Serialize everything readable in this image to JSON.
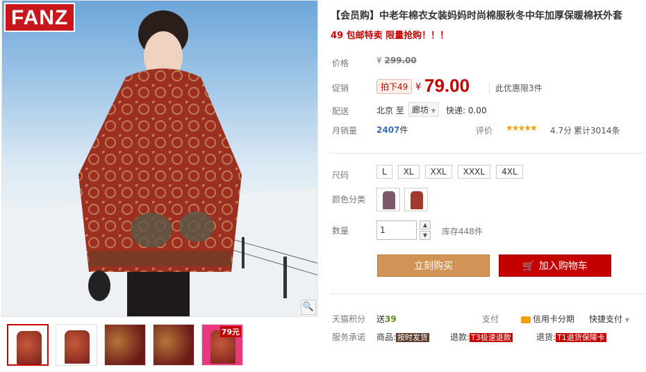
{
  "brand": "FANZ",
  "product": {
    "title": "【会员购】中老年棉衣女装妈妈时尚棉服秋冬中年加厚保暖棉袄外套",
    "subtitle": "49 包邮特卖 限量抢购！！！"
  },
  "price": {
    "label": "价格",
    "currency": "¥",
    "original": "299.00"
  },
  "promo": {
    "label": "促销",
    "tag": "拍下49",
    "currency": "¥",
    "price": "79.00",
    "limit": "此优惠限3件"
  },
  "shipping": {
    "label": "配送",
    "from": "北京 至",
    "destination": "廊坊",
    "fee": "快递: 0.00"
  },
  "sales": {
    "label": "月销量",
    "count": "2407",
    "unit": "件"
  },
  "rating": {
    "label": "评价",
    "stars": 4.7,
    "score": "4.7分",
    "count": "累计3014条"
  },
  "size": {
    "label": "尺码",
    "options": [
      "L",
      "XL",
      "XXL",
      "XXXL",
      "4XL"
    ]
  },
  "color": {
    "label": "颜色分类",
    "swatches": [
      "#7a5a6a",
      "#a03a2c"
    ]
  },
  "quantity": {
    "label": "数量",
    "value": "1",
    "stock": "库存448件"
  },
  "actions": {
    "buy": "立刻购买",
    "cart": "加入购物车"
  },
  "points": {
    "label": "天猫积分",
    "prefix": "送",
    "value": "39"
  },
  "payment": {
    "label": "支付",
    "card": "信用卡分期",
    "quick": "快捷支付"
  },
  "promise": {
    "label": "服务承诺",
    "goods_label": "商品:",
    "goods_tag": "按时发货",
    "refund_label": "退款:",
    "refund_tag": "T3极速退款",
    "return_label": "退货:",
    "return_tag": "T1退货保障卡"
  },
  "thumbnails": {
    "badge": "79元"
  },
  "colors": {
    "accent_red": "#c40000",
    "buy_button": "#d29456",
    "link_blue": "#3c6cb4"
  }
}
